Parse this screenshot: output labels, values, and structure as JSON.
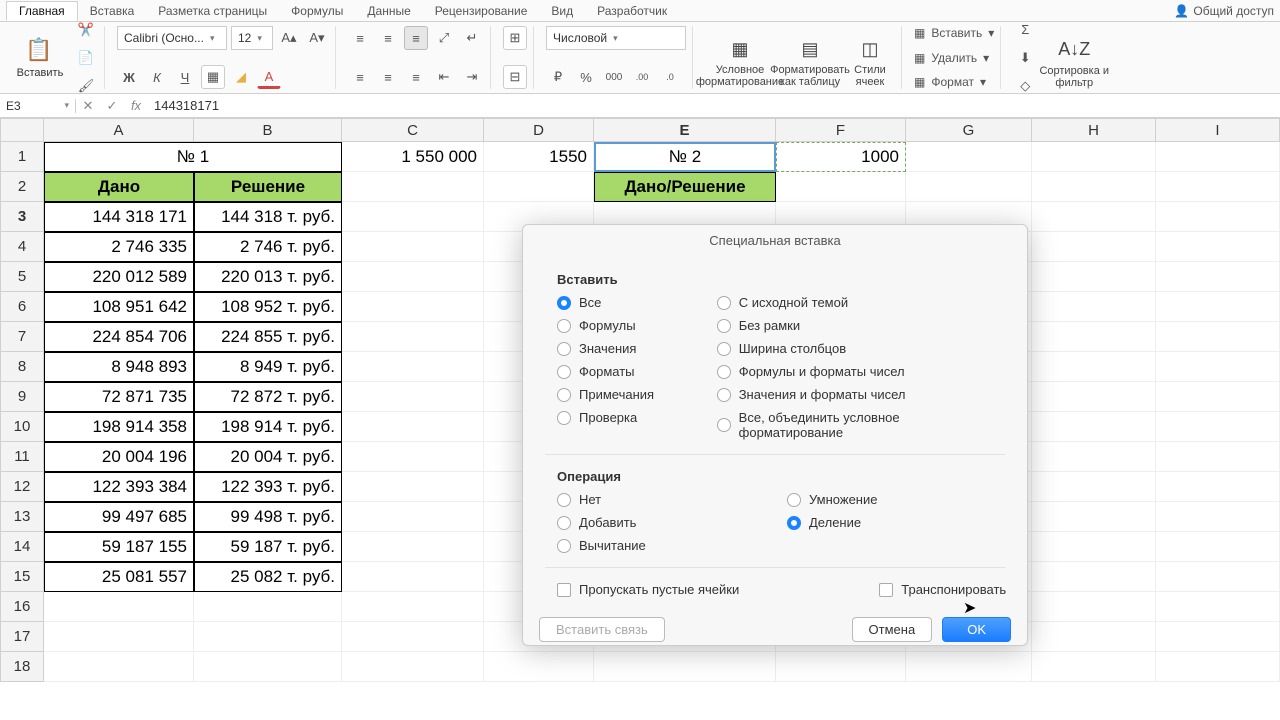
{
  "tabs": [
    "Главная",
    "Вставка",
    "Разметка страницы",
    "Формулы",
    "Данные",
    "Рецензирование",
    "Вид",
    "Разработчик"
  ],
  "share": "Общий доступ",
  "ribbon": {
    "paste": "Вставить",
    "font_name": "Calibri (Осно...",
    "font_size": "12",
    "num_format": "Числовой",
    "cond_fmt": "Условное форматирование",
    "fmt_table": "Форматировать как таблицу",
    "styles": "Стили ячеек",
    "insert": "Вставить",
    "delete": "Удалить",
    "format": "Формат",
    "sort": "Сортировка и фильтр"
  },
  "namebox": "E3",
  "formula": "144318171",
  "col_labels": [
    "A",
    "B",
    "C",
    "D",
    "E",
    "F",
    "G",
    "H",
    "I"
  ],
  "row_labels": [
    "1",
    "2",
    "3",
    "4",
    "5",
    "6",
    "7",
    "8",
    "9",
    "10",
    "11",
    "12",
    "13",
    "14",
    "15",
    "16",
    "17",
    "18"
  ],
  "cells": {
    "r1": {
      "AB": "№ 1",
      "C": "1 550 000",
      "D": "1550",
      "E": "№ 2",
      "F": "1000"
    },
    "r2": {
      "A": "Дано",
      "B": "Решение",
      "E": "Дано/Решение"
    },
    "data": [
      {
        "A": "144 318 171",
        "B": "144 318 т. руб."
      },
      {
        "A": "2 746 335",
        "B": "2 746 т. руб."
      },
      {
        "A": "220 012 589",
        "B": "220 013 т. руб."
      },
      {
        "A": "108 951 642",
        "B": "108 952 т. руб."
      },
      {
        "A": "224 854 706",
        "B": "224 855 т. руб."
      },
      {
        "A": "8 948 893",
        "B": "8 949 т. руб."
      },
      {
        "A": "72 871 735",
        "B": "72 872 т. руб."
      },
      {
        "A": "198 914 358",
        "B": "198 914 т. руб."
      },
      {
        "A": "20 004 196",
        "B": "20 004 т. руб."
      },
      {
        "A": "122 393 384",
        "B": "122 393 т. руб."
      },
      {
        "A": "99 497 685",
        "B": "99 498 т. руб."
      },
      {
        "A": "59 187 155",
        "B": "59 187 т. руб."
      },
      {
        "A": "25 081 557",
        "B": "25 082 т. руб."
      }
    ]
  },
  "dialog": {
    "title": "Специальная вставка",
    "sect_paste": "Вставить",
    "paste_opts_l": [
      "Все",
      "Формулы",
      "Значения",
      "Форматы",
      "Примечания",
      "Проверка"
    ],
    "paste_opts_r": [
      "С исходной темой",
      "Без рамки",
      "Ширина столбцов",
      "Формулы и форматы чисел",
      "Значения и форматы чисел",
      "Все, объединить условное форматирование"
    ],
    "paste_sel": "Все",
    "sect_op": "Операция",
    "op_opts_l": [
      "Нет",
      "Добавить",
      "Вычитание"
    ],
    "op_opts_r": [
      "Умножение",
      "Деление"
    ],
    "op_sel": "Деление",
    "skip_blanks": "Пропускать пустые ячейки",
    "transpose": "Транспонировать",
    "paste_link": "Вставить связь",
    "cancel": "Отмена",
    "ok": "OK"
  }
}
